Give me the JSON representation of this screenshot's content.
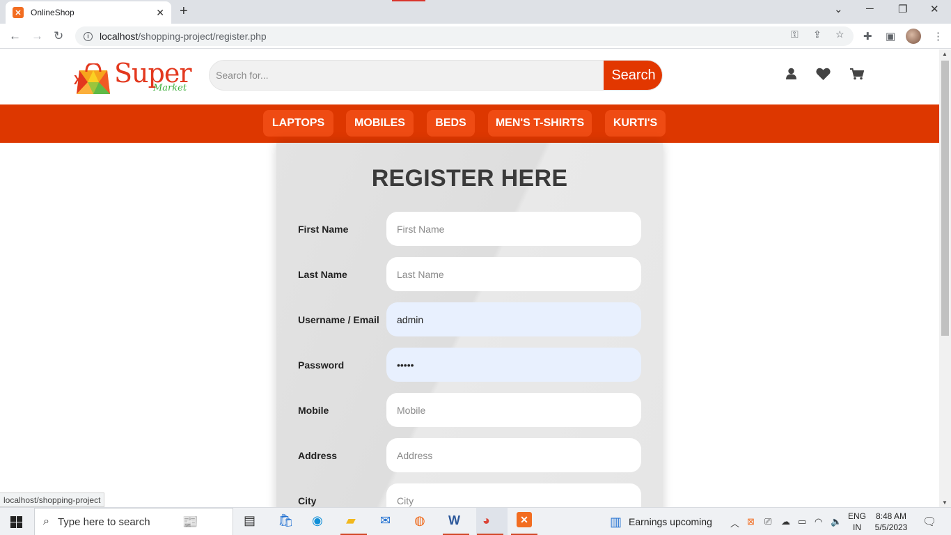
{
  "browser": {
    "tab_title": "OnlineShop",
    "url_host": "localhost",
    "url_path": "/shopping-project/register.php"
  },
  "header": {
    "logo_main": "Super",
    "logo_sub": "Market",
    "search_placeholder": "Search for...",
    "search_button": "Search"
  },
  "categories": [
    "LAPTOPS",
    "MOBILES",
    "BEDS",
    "MEN'S T-SHIRTS",
    "KURTI'S"
  ],
  "form": {
    "title": "REGISTER HERE",
    "fields": [
      {
        "label": "First Name",
        "placeholder": "First Name",
        "value": ""
      },
      {
        "label": "Last Name",
        "placeholder": "Last Name",
        "value": ""
      },
      {
        "label": "Username / Email",
        "placeholder": "",
        "value": "admin"
      },
      {
        "label": "Password",
        "placeholder": "",
        "value": "•••••"
      },
      {
        "label": "Mobile",
        "placeholder": "Mobile",
        "value": ""
      },
      {
        "label": "Address",
        "placeholder": "Address",
        "value": ""
      },
      {
        "label": "City",
        "placeholder": "City",
        "value": ""
      }
    ]
  },
  "status_url": "localhost/shopping-project",
  "taskbar": {
    "search_text": "Type here to search",
    "news": "Earnings upcoming",
    "lang_top": "ENG",
    "lang_bottom": "IN",
    "time": "8:48 AM",
    "date": "5/5/2023"
  },
  "colors": {
    "accent": "#dd3700",
    "category_button": "#ef4b13",
    "logo_red": "#e3381e",
    "logo_green": "#3fae3d",
    "autofill": "#e8f0fe"
  }
}
